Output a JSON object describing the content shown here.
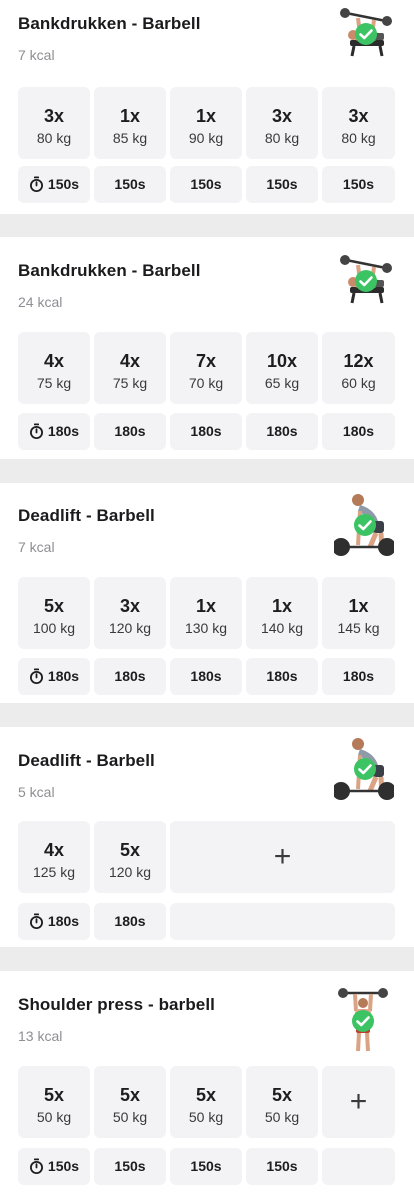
{
  "exercises": [
    {
      "title": "Bankdrukken - Barbell",
      "kcal": "7 kcal",
      "thumbnail_icon": "bench-press-icon",
      "completed_badge_icon": "check-circle-icon",
      "sets": [
        {
          "reps": "3x",
          "weight": "80 kg"
        },
        {
          "reps": "1x",
          "weight": "85 kg"
        },
        {
          "reps": "1x",
          "weight": "90 kg"
        },
        {
          "reps": "3x",
          "weight": "80 kg"
        },
        {
          "reps": "3x",
          "weight": "80 kg"
        }
      ],
      "rest": [
        "150s",
        "150s",
        "150s",
        "150s",
        "150s"
      ]
    },
    {
      "title": "Bankdrukken - Barbell",
      "kcal": "24 kcal",
      "thumbnail_icon": "bench-press-icon",
      "completed_badge_icon": "check-circle-icon",
      "sets": [
        {
          "reps": "4x",
          "weight": "75 kg"
        },
        {
          "reps": "4x",
          "weight": "75 kg"
        },
        {
          "reps": "7x",
          "weight": "70 kg"
        },
        {
          "reps": "10x",
          "weight": "65 kg"
        },
        {
          "reps": "12x",
          "weight": "60 kg"
        }
      ],
      "rest": [
        "180s",
        "180s",
        "180s",
        "180s",
        "180s"
      ]
    },
    {
      "title": "Deadlift - Barbell",
      "kcal": "7 kcal",
      "thumbnail_icon": "deadlift-icon",
      "completed_badge_icon": "check-circle-icon",
      "sets": [
        {
          "reps": "5x",
          "weight": "100 kg"
        },
        {
          "reps": "3x",
          "weight": "120 kg"
        },
        {
          "reps": "1x",
          "weight": "130 kg"
        },
        {
          "reps": "1x",
          "weight": "140 kg"
        },
        {
          "reps": "1x",
          "weight": "145 kg"
        }
      ],
      "rest": [
        "180s",
        "180s",
        "180s",
        "180s",
        "180s"
      ]
    },
    {
      "title": "Deadlift - Barbell",
      "kcal": "5 kcal",
      "thumbnail_icon": "deadlift-icon",
      "completed_badge_icon": "check-circle-icon",
      "sets": [
        {
          "reps": "4x",
          "weight": "125 kg"
        },
        {
          "reps": "5x",
          "weight": "120 kg"
        }
      ],
      "add_set_symbol": "+",
      "rest": [
        "180s",
        "180s"
      ]
    },
    {
      "title": "Shoulder press - barbell",
      "kcal": "13 kcal",
      "thumbnail_icon": "shoulder-press-icon",
      "completed_badge_icon": "check-circle-icon",
      "sets": [
        {
          "reps": "5x",
          "weight": "50 kg"
        },
        {
          "reps": "5x",
          "weight": "50 kg"
        },
        {
          "reps": "5x",
          "weight": "50 kg"
        },
        {
          "reps": "5x",
          "weight": "50 kg"
        }
      ],
      "add_set_symbol": "+",
      "rest": [
        "150s",
        "150s",
        "150s",
        "150s"
      ]
    }
  ],
  "colors": {
    "page_background": "#ececec",
    "card_background": "#ffffff",
    "cell_background": "#f3f3f5",
    "badge_green": "#3cc464",
    "muted_text": "#8e8e93"
  }
}
